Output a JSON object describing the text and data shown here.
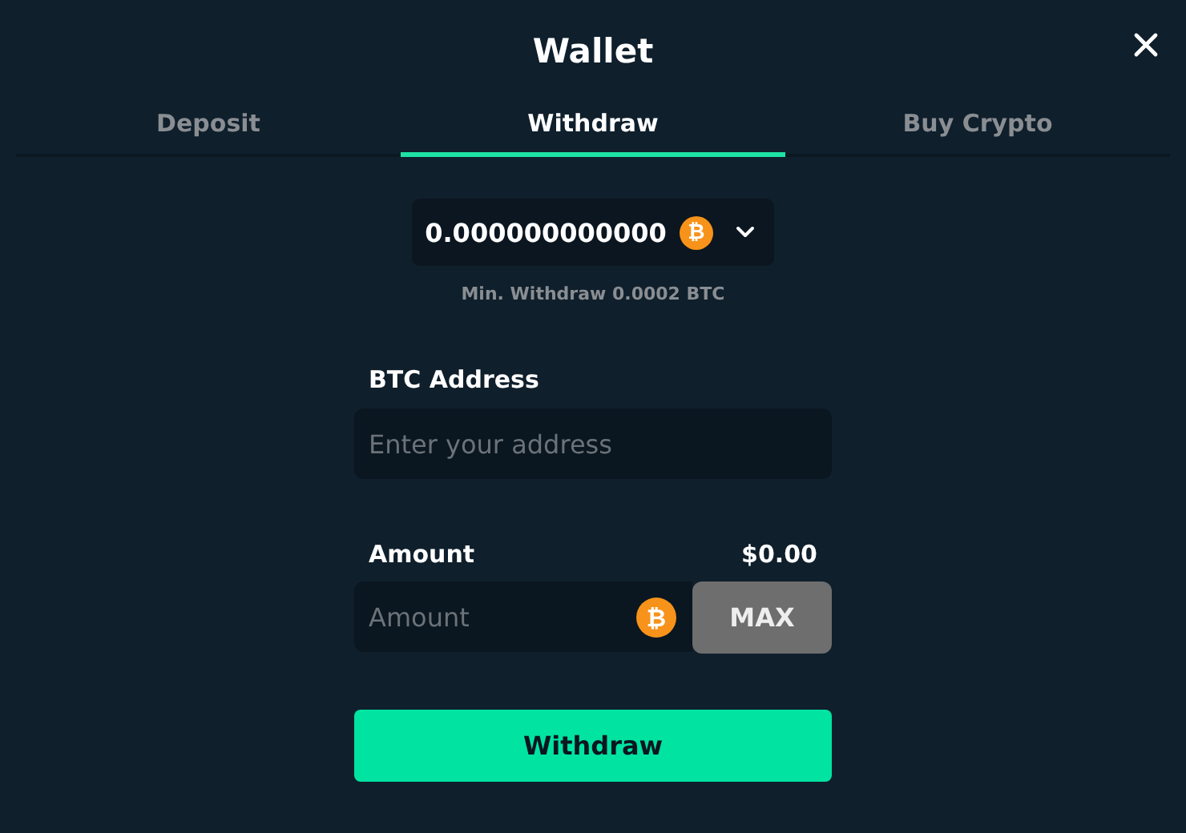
{
  "window": {
    "title": "Wallet"
  },
  "tabs": [
    {
      "label": "Deposit",
      "selected": false
    },
    {
      "label": "Withdraw",
      "selected": true
    },
    {
      "label": "Buy Crypto",
      "selected": false
    }
  ],
  "selector": {
    "value": "0.000000000000",
    "coin_symbol": "₿"
  },
  "min_withdraw": "Min. Withdraw 0.0002 BTC",
  "address": {
    "label": "BTC Address",
    "placeholder": "Enter your address"
  },
  "amount": {
    "label": "Amount",
    "usd_value": "$0.00",
    "placeholder": "Amount",
    "coin_symbol": "₿",
    "max_button": "MAX"
  },
  "submit_button": "Withdraw"
}
